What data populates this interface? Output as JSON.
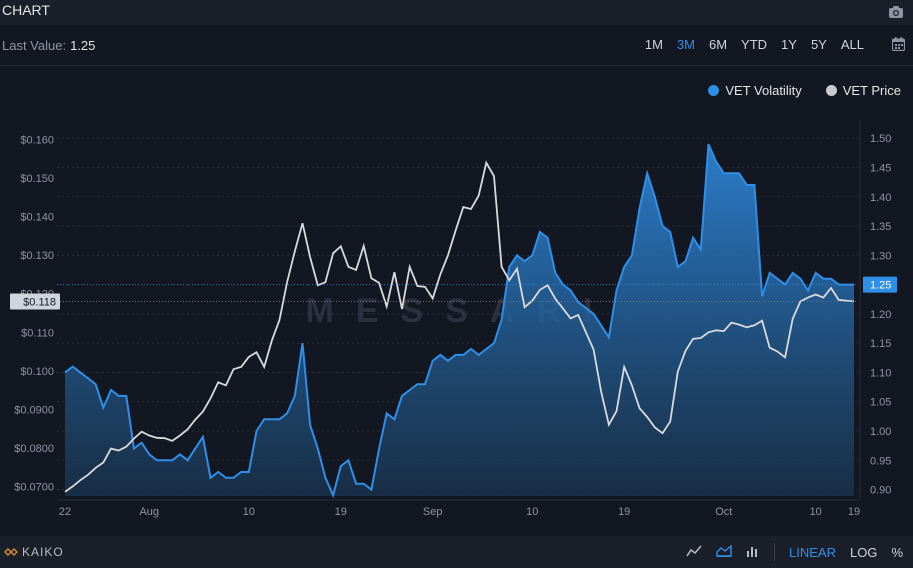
{
  "header": {
    "title": "CHART",
    "camera_icon": "camera-icon"
  },
  "toolbar": {
    "last_value_label": "Last Value:",
    "last_value": "1.25",
    "ranges": [
      "1M",
      "3M",
      "6M",
      "YTD",
      "1Y",
      "5Y",
      "ALL"
    ],
    "active_range": "3M",
    "calendar_icon": "calendar-icon"
  },
  "watermark": "MESSARI",
  "footer": {
    "provider": "KAIKO",
    "line_icon": "line-chart-icon",
    "area_icon": "area-chart-icon",
    "bar_icon": "bar-chart-icon",
    "linear": "LINEAR",
    "log": "LOG",
    "percent": "%"
  },
  "colors": {
    "volatility": "#2f8fe8",
    "price": "#c8cad0",
    "background": "#131722"
  },
  "chart_data": {
    "type": "area",
    "series": [
      {
        "name": "VET Volatility",
        "axis": "right",
        "style": "area",
        "values": [
          1.1,
          1.11,
          1.1,
          1.09,
          1.08,
          1.04,
          1.07,
          1.06,
          1.06,
          0.97,
          0.98,
          0.96,
          0.95,
          0.95,
          0.95,
          0.96,
          0.95,
          0.97,
          0.99,
          0.92,
          0.93,
          0.92,
          0.92,
          0.93,
          0.93,
          1.0,
          1.02,
          1.02,
          1.02,
          1.03,
          1.06,
          1.15,
          1.01,
          0.97,
          0.92,
          0.89,
          0.94,
          0.95,
          0.91,
          0.91,
          0.9,
          0.97,
          1.03,
          1.02,
          1.06,
          1.07,
          1.08,
          1.08,
          1.12,
          1.13,
          1.12,
          1.13,
          1.13,
          1.14,
          1.13,
          1.14,
          1.15,
          1.19,
          1.28,
          1.3,
          1.29,
          1.3,
          1.34,
          1.33,
          1.27,
          1.25,
          1.24,
          1.22,
          1.21,
          1.2,
          1.18,
          1.16,
          1.24,
          1.28,
          1.3,
          1.38,
          1.44,
          1.4,
          1.35,
          1.34,
          1.28,
          1.29,
          1.33,
          1.31,
          1.49,
          1.46,
          1.44,
          1.44,
          1.44,
          1.42,
          1.42,
          1.23,
          1.27,
          1.26,
          1.25,
          1.27,
          1.26,
          1.24,
          1.27,
          1.26,
          1.26,
          1.25,
          1.25,
          1.25
        ]
      },
      {
        "name": "VET Price",
        "axis": "left",
        "style": "line",
        "values": [
          0.0686,
          0.07,
          0.0716,
          0.073,
          0.0748,
          0.0762,
          0.0798,
          0.0793,
          0.0803,
          0.0824,
          0.0842,
          0.0832,
          0.0826,
          0.0825,
          0.0818,
          0.0832,
          0.0848,
          0.0873,
          0.0894,
          0.0928,
          0.097,
          0.0962,
          0.1004,
          0.101,
          0.1036,
          0.1048,
          0.101,
          0.1078,
          0.1132,
          0.123,
          0.131,
          0.1383,
          0.1295,
          0.1222,
          0.123,
          0.1305,
          0.1323,
          0.127,
          0.1262,
          0.1324,
          0.124,
          0.1228,
          0.1167,
          0.1256,
          0.116,
          0.127,
          0.122,
          0.1218,
          0.1188,
          0.125,
          0.13,
          0.1365,
          0.1425,
          0.142,
          0.1455,
          0.154,
          0.1505,
          0.127,
          0.1235,
          0.1265,
          0.1165,
          0.1182,
          0.121,
          0.1222,
          0.1187,
          0.1162,
          0.1136,
          0.1145,
          0.11,
          0.1055,
          0.0945,
          0.086,
          0.0895,
          0.101,
          0.0962,
          0.0903,
          0.088,
          0.0853,
          0.0838,
          0.0868,
          0.0998,
          0.1052,
          0.1083,
          0.1085,
          0.11,
          0.1105,
          0.1103,
          0.1125,
          0.112,
          0.1113,
          0.1118,
          0.113,
          0.106,
          0.105,
          0.1035,
          0.1135,
          0.118,
          0.119,
          0.1198,
          0.119,
          0.1215,
          0.1184,
          0.1182,
          0.118
        ]
      }
    ],
    "x_tick_labels": [
      "22",
      "Aug",
      "10",
      "19",
      "Sep",
      "10",
      "19",
      "Oct",
      "10",
      "19"
    ],
    "y_left": {
      "ticks": [
        "$0.0700",
        "$0.0800",
        "$0.0900",
        "$0.100",
        "$0.110",
        "$0.120",
        "$0.130",
        "$0.140",
        "$0.150",
        "$0.160"
      ],
      "tick_values": [
        0.07,
        0.08,
        0.09,
        0.1,
        0.11,
        0.12,
        0.13,
        0.14,
        0.15,
        0.16
      ],
      "range": [
        0.0675,
        0.1625
      ]
    },
    "y_right": {
      "ticks": [
        "0.90",
        "0.95",
        "1.00",
        "1.05",
        "1.10",
        "1.15",
        "1.20",
        "1.25",
        "1.30",
        "1.35",
        "1.40",
        "1.45",
        "1.50"
      ],
      "tick_values": [
        0.9,
        0.95,
        1.0,
        1.05,
        1.1,
        1.15,
        1.2,
        1.25,
        1.3,
        1.35,
        1.4,
        1.45,
        1.5
      ],
      "range": [
        0.889,
        1.514
      ]
    },
    "crosshair_left_label": "$0.118",
    "crosshair_left_value": 0.118,
    "last_value_right_label": "1.25",
    "last_value_right_value": 1.25,
    "legend_placement": "top-right",
    "grid": true
  }
}
